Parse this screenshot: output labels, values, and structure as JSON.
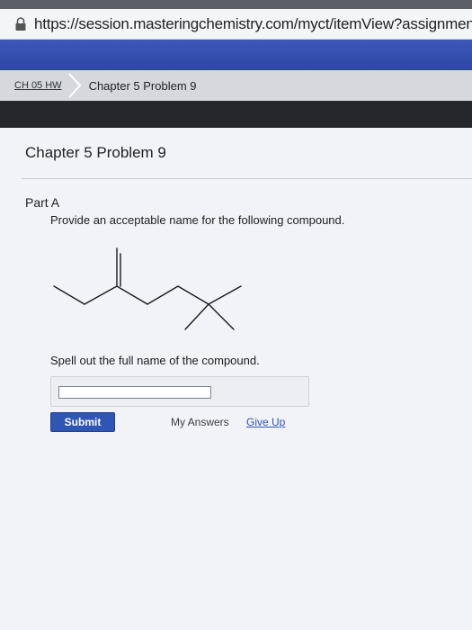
{
  "browser": {
    "url": "https://session.masteringchemistry.com/myct/itemView?assignmentPr"
  },
  "breadcrumb": {
    "assignment": "CH 05 HW",
    "current": "Chapter 5 Problem 9"
  },
  "problem": {
    "title": "Chapter 5 Problem 9",
    "part": "Part A",
    "question": "Provide an acceptable name for the following compound.",
    "instruction": "Spell out the full name of the compound."
  },
  "answer": {
    "value": "",
    "placeholder": ""
  },
  "actions": {
    "submit": "Submit",
    "my_answers": "My Answers",
    "give_up": "Give Up"
  },
  "colors": {
    "header_blue": "#2d47a2",
    "dark_band": "#25272c",
    "submit_button": "#2f55b5",
    "link": "#2f55b5"
  }
}
